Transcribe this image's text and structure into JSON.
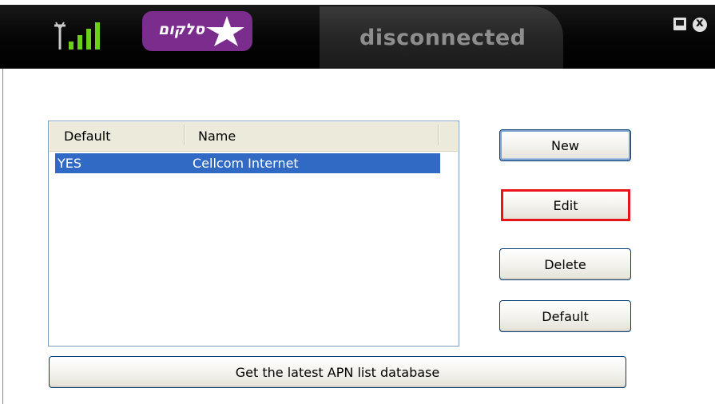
{
  "titlebar": {
    "logo_text": "סלקום",
    "status": "disconnected",
    "signal_strength": "4 of 4 bars",
    "icons": [
      "signal-antenna-icon",
      "brand-star-icon",
      "minimize-icon",
      "close-icon"
    ]
  },
  "apn_list": {
    "columns": [
      "Default",
      "Name"
    ],
    "rows": [
      {
        "default": "YES",
        "name": "Cellcom Internet",
        "selected": true
      }
    ]
  },
  "buttons": {
    "new": "New",
    "edit": "Edit",
    "delete": "Delete",
    "default": "Default",
    "get_apn": "Get the latest APN list database"
  },
  "colors": {
    "selection": "#316ac5",
    "brand_purple": "#7a2d8c",
    "highlight_outline": "#e8141a",
    "signal_green": "#6ad01a"
  }
}
